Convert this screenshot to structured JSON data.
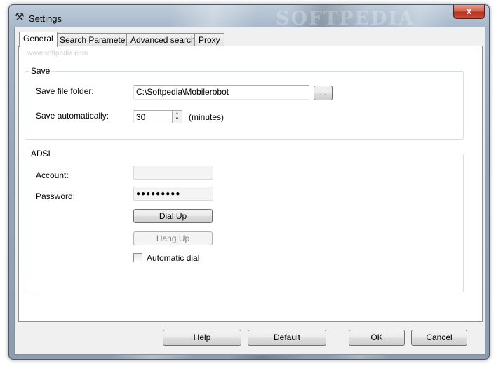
{
  "window": {
    "title": "Settings",
    "icon": "tools-icon",
    "watermark": "SOFTPEDIA",
    "close_label": "x"
  },
  "tabs": [
    "General",
    "Search Parameters",
    "Advanced search",
    "Proxy"
  ],
  "active_tab": "General",
  "watermark_url": "www.softpedia.com",
  "save_group": {
    "title": "Save",
    "folder_label": "Save file folder:",
    "folder_value": "C:\\Softpedia\\Mobilerobot",
    "browse_label": "...",
    "auto_label": "Save automatically:",
    "auto_value": "30",
    "auto_unit": "(minutes)"
  },
  "adsl_group": {
    "title": "ADSL",
    "account_label": "Account:",
    "account_value": "",
    "password_label": "Password:",
    "password_value": "●●●●●●●●●",
    "dial_up_label": "Dial Up",
    "hang_up_label": "Hang Up",
    "automatic_dial_label": "Automatic dial",
    "automatic_dial_checked": false
  },
  "footer": {
    "help_label": "Help",
    "default_label": "Default",
    "ok_label": "OK",
    "cancel_label": "Cancel"
  }
}
